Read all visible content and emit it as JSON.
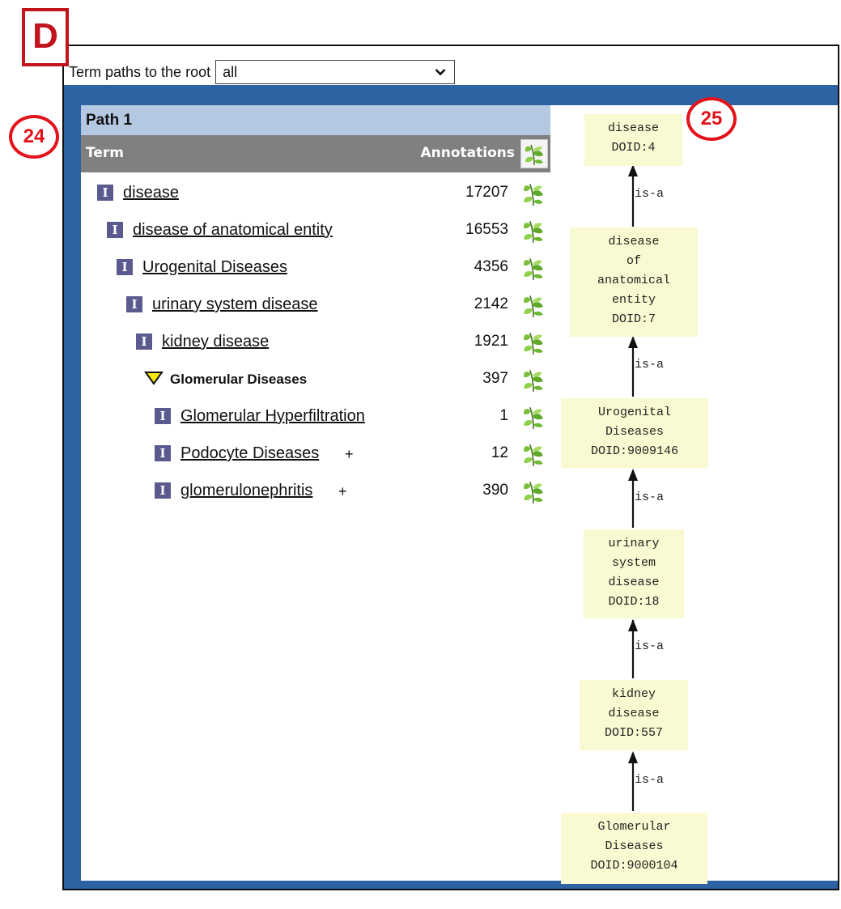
{
  "panel_label": "D",
  "callouts": [
    "24",
    "25"
  ],
  "paths_selector": {
    "label": "Term paths to the root",
    "value": "all"
  },
  "path_header": "Path 1",
  "columns": {
    "term": "Term",
    "annotations": "Annotations"
  },
  "rows": [
    {
      "term": "disease",
      "count": "17207",
      "plus": ""
    },
    {
      "term": "disease of anatomical entity",
      "count": "16553",
      "plus": ""
    },
    {
      "term": "Urogenital Diseases",
      "count": "4356",
      "plus": ""
    },
    {
      "term": "urinary system disease",
      "count": "2142",
      "plus": ""
    },
    {
      "term": "kidney disease",
      "count": "1921",
      "plus": ""
    },
    {
      "term": "Glomerular Diseases",
      "count": "397",
      "plus": ""
    },
    {
      "term": "Glomerular Hyperfiltration",
      "count": "1",
      "plus": ""
    },
    {
      "term": "Podocyte Diseases",
      "count": "12",
      "plus": "+"
    },
    {
      "term": "glomerulonephritis",
      "count": "390",
      "plus": "+"
    }
  ],
  "graph": {
    "nodes": [
      {
        "lines": [
          "disease",
          "DOID:4"
        ]
      },
      {
        "lines": [
          "disease",
          "of",
          "anatomical",
          "entity",
          "DOID:7"
        ]
      },
      {
        "lines": [
          "Urogenital",
          "Diseases",
          "DOID:9009146"
        ]
      },
      {
        "lines": [
          "urinary",
          "system",
          "disease",
          "DOID:18"
        ]
      },
      {
        "lines": [
          "kidney",
          "disease",
          "DOID:557"
        ]
      },
      {
        "lines": [
          "Glomerular",
          "Diseases",
          "DOID:9000104"
        ]
      }
    ],
    "edge_label": "is-a"
  },
  "colors": {
    "frame_blue": "#2d62a3",
    "path_header": "#b4c8e2",
    "column_header": "#808080",
    "node_fill": "#fafad2",
    "callout_red": "#e3131b"
  },
  "icons": {
    "info": "info-i-icon",
    "annotation": "leaf-icon",
    "expanded": "triangle-down-icon",
    "dropdown": "chevron-down-icon"
  }
}
